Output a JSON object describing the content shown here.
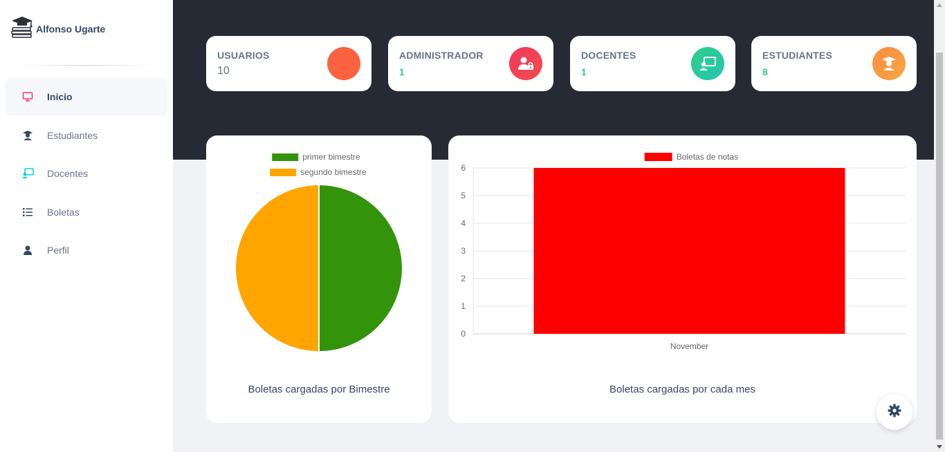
{
  "brand": {
    "name": "Alfonso Ugarte",
    "icon": "graduation-books-icon"
  },
  "sidebar": {
    "items": [
      {
        "label": "Inicio",
        "icon": "monitor-icon",
        "active": true
      },
      {
        "label": "Estudiantes",
        "icon": "student-icon"
      },
      {
        "label": "Docentes",
        "icon": "teacher-board-icon"
      },
      {
        "label": "Boletas",
        "icon": "list-icon"
      },
      {
        "label": "Perfil",
        "icon": "user-icon"
      }
    ]
  },
  "stats": [
    {
      "title": "USUARIOS",
      "value": "10",
      "icon": "circle-icon",
      "color": "#fb6340"
    },
    {
      "title": "ADMINISTRADOR",
      "value": "1",
      "icon": "user-lock-icon",
      "color": "#f5365c"
    },
    {
      "title": "DOCENTES",
      "value": "1",
      "icon": "teacher-board-icon",
      "color": "#2dcea0"
    },
    {
      "title": "ESTUDIANTES",
      "value": "8",
      "icon": "student-icon",
      "color": "#fb8c40"
    }
  ],
  "chart_data": [
    {
      "type": "pie",
      "labels": [
        "primer bimestre",
        "segundo bimestre"
      ],
      "values": [
        1,
        1
      ],
      "colors": [
        "#33940c",
        "#ffa500"
      ],
      "legend": "top",
      "caption": "Boletas cargadas por Bimestre"
    },
    {
      "type": "bar",
      "categories": [
        "November"
      ],
      "series": [
        {
          "name": "Boletas de notas",
          "values": [
            6
          ],
          "color": "#ff0000"
        }
      ],
      "ylim": [
        0,
        6
      ],
      "yticks": [
        "0",
        "1",
        "2",
        "3",
        "4",
        "5",
        "6"
      ],
      "grid": true,
      "legend": "top",
      "caption": "Boletas cargadas por cada mes"
    }
  ],
  "settings": {
    "icon": "gear-icon"
  }
}
